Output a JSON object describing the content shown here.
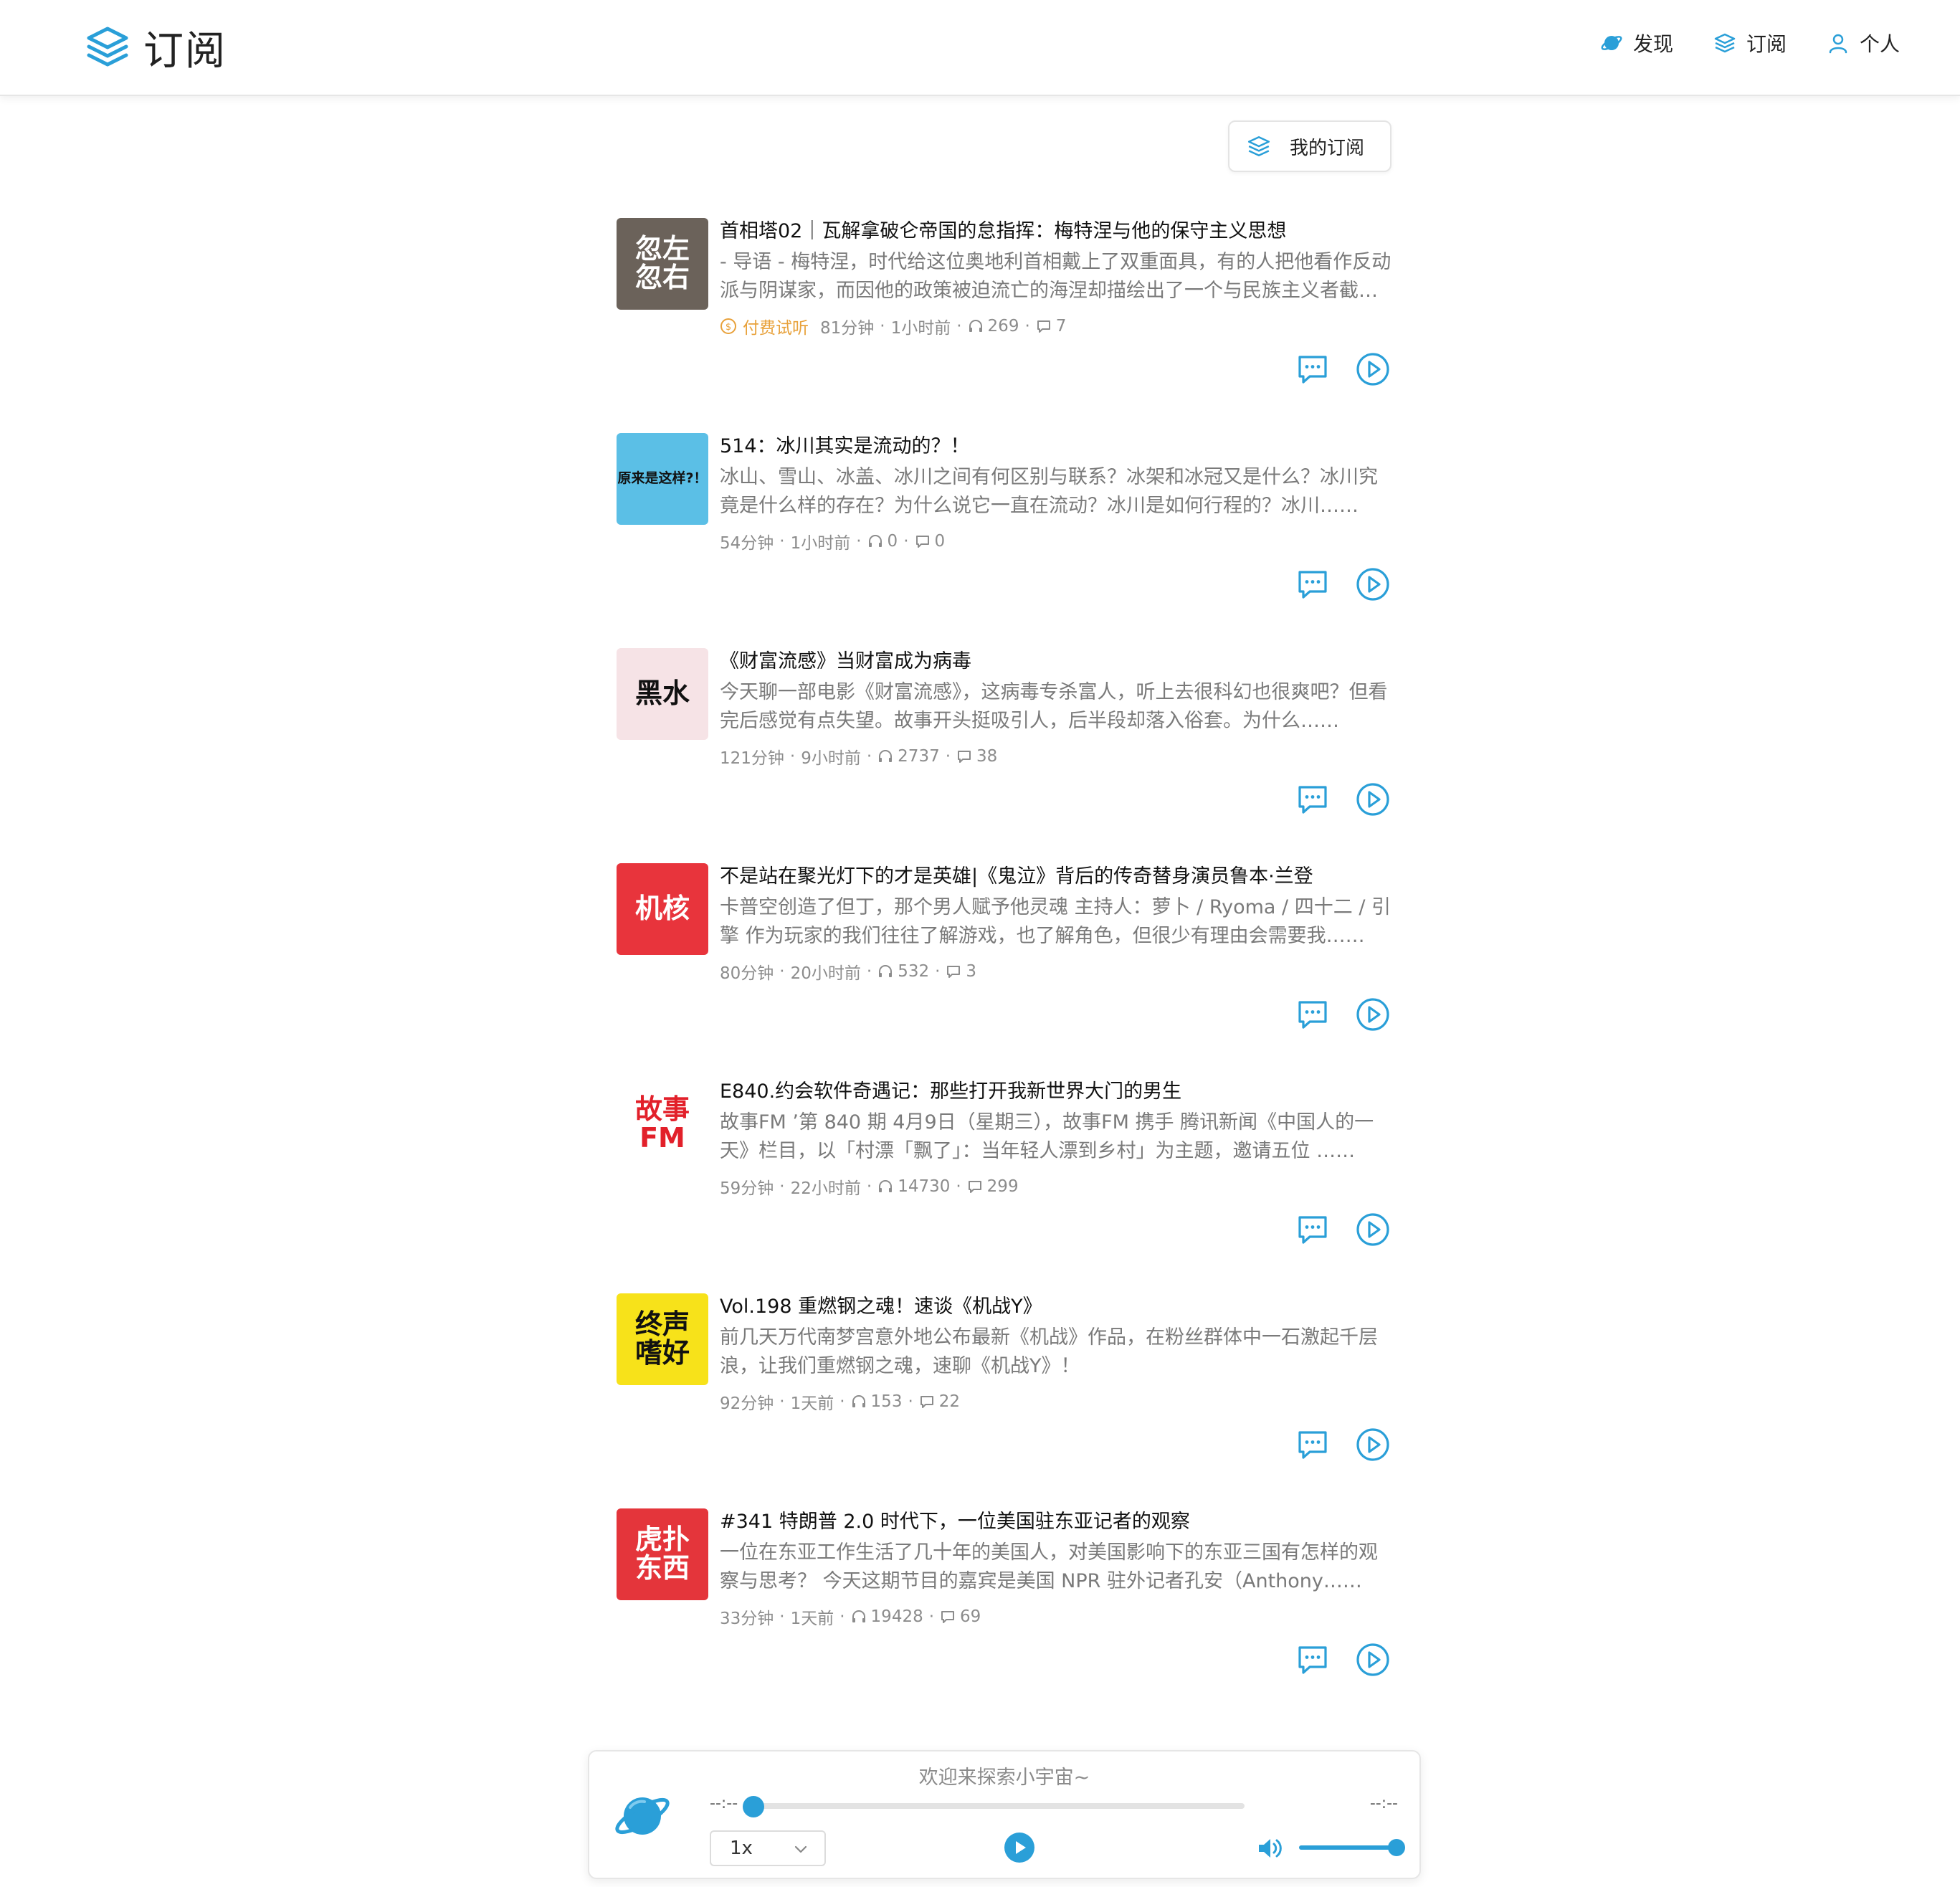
{
  "header": {
    "title": "订阅",
    "nav": [
      {
        "label": "发现",
        "icon": "planet-icon"
      },
      {
        "label": "订阅",
        "icon": "layers-icon"
      },
      {
        "label": "个人",
        "icon": "user-icon"
      }
    ]
  },
  "my_subscriptions_label": "我的订阅",
  "episodes": [
    {
      "cover_text": "忽左\n忽右",
      "cover_bg": "#6b625a",
      "cover_fg": "#ffffff",
      "title": "首相塔02｜瓦解拿破仑帝国的怠指挥：梅特涅与他的保守主义思想",
      "description": "- 导语 - 梅特涅，时代给这位奥地利首相戴上了双重面具，有的人把他看作反动派与阴谋家，而因他的政策被迫流亡的海涅却描绘出了一个与民族主义者截然不同的形象……",
      "paid_label": "付费试听",
      "duration": "81分钟",
      "time_ago": "1小时前",
      "plays": "269",
      "comments": "7"
    },
    {
      "cover_text": "原来是这样?！",
      "cover_bg": "#5bbfe6",
      "cover_fg": "#111111",
      "title": "514：冰川其实是流动的？！",
      "description": "冰山、雪山、冰盖、冰川之间有何区别与联系？冰架和冰冠又是什么？冰川究竟是什么样的存在？为什么说它一直在流动？冰川是如何行程的？冰川……",
      "paid_label": "",
      "duration": "54分钟",
      "time_ago": "1小时前",
      "plays": "0",
      "comments": "0"
    },
    {
      "cover_text": "黑水",
      "cover_bg": "#f6e3e6",
      "cover_fg": "#111111",
      "title": "《财富流感》当财富成为病毒",
      "description": "今天聊一部电影《财富流感》，这病毒专杀富人，听上去很科幻也很爽吧？但看完后感觉有点失望。故事开头挺吸引人，后半段却落入俗套。为什么……",
      "paid_label": "",
      "duration": "121分钟",
      "time_ago": "9小时前",
      "plays": "2737",
      "comments": "38"
    },
    {
      "cover_text": "机核",
      "cover_bg": "#e8343c",
      "cover_fg": "#ffffff",
      "title": "不是站在聚光灯下的才是英雄|《鬼泣》背后的传奇替身演员鲁本·兰登",
      "description": "卡普空创造了但丁，那个男人赋予他灵魂 主持人：萝卜 / Ryoma / 四十二 / 引擎 作为玩家的我们往往了解游戏，也了解角色，但很少有理由会需要我……",
      "paid_label": "",
      "duration": "80分钟",
      "time_ago": "20小时前",
      "plays": "532",
      "comments": "3"
    },
    {
      "cover_text": "故事\nFM",
      "cover_bg": "#ffffff",
      "cover_fg": "#e2202a",
      "title": "E840.约会软件奇遇记：那些打开我新世界大门的男生",
      "description": "故事FM ʼ第 840 期 4月9日（星期三），故事FM 携手 腾讯新闻《中国人的一天》栏目，以「村漂「飘了」：当年轻人漂到乡村」为主题，邀请五位 ……",
      "paid_label": "",
      "duration": "59分钟",
      "time_ago": "22小时前",
      "plays": "14730",
      "comments": "299"
    },
    {
      "cover_text": "终声\n嗜好",
      "cover_bg": "#f7e21a",
      "cover_fg": "#111111",
      "title": "Vol.198 重燃钢之魂！速谈《机战Y》",
      "description": "前几天万代南梦宫意外地公布最新《机战》作品，在粉丝群体中一石激起千层浪，让我们重燃钢之魂，速聊《机战Y》！",
      "paid_label": "",
      "duration": "92分钟",
      "time_ago": "1天前",
      "plays": "153",
      "comments": "22"
    },
    {
      "cover_text": "虎扑\n东西",
      "cover_bg": "#e4353b",
      "cover_fg": "#ffffff",
      "title": "#341 特朗普 2.0 时代下，一位美国驻东亚记者的观察",
      "description": "一位在东亚工作生活了几十年的美国人，对美国影响下的东亚三国有怎样的观察与思考？ 今天这期节目的嘉宾是美国 NPR 驻外记者孔安（Anthony……",
      "paid_label": "",
      "duration": "33分钟",
      "time_ago": "1天前",
      "plays": "19428",
      "comments": "69"
    }
  ],
  "player": {
    "title": "欢迎来探索小宇宙~",
    "time_current": "--:--",
    "time_total": "--:--",
    "progress": 0,
    "speed": "1x",
    "volume": 1.0
  },
  "colors": {
    "accent": "#2a9fd8",
    "paid": "#e8a13a",
    "muted": "#8c8c8c"
  }
}
